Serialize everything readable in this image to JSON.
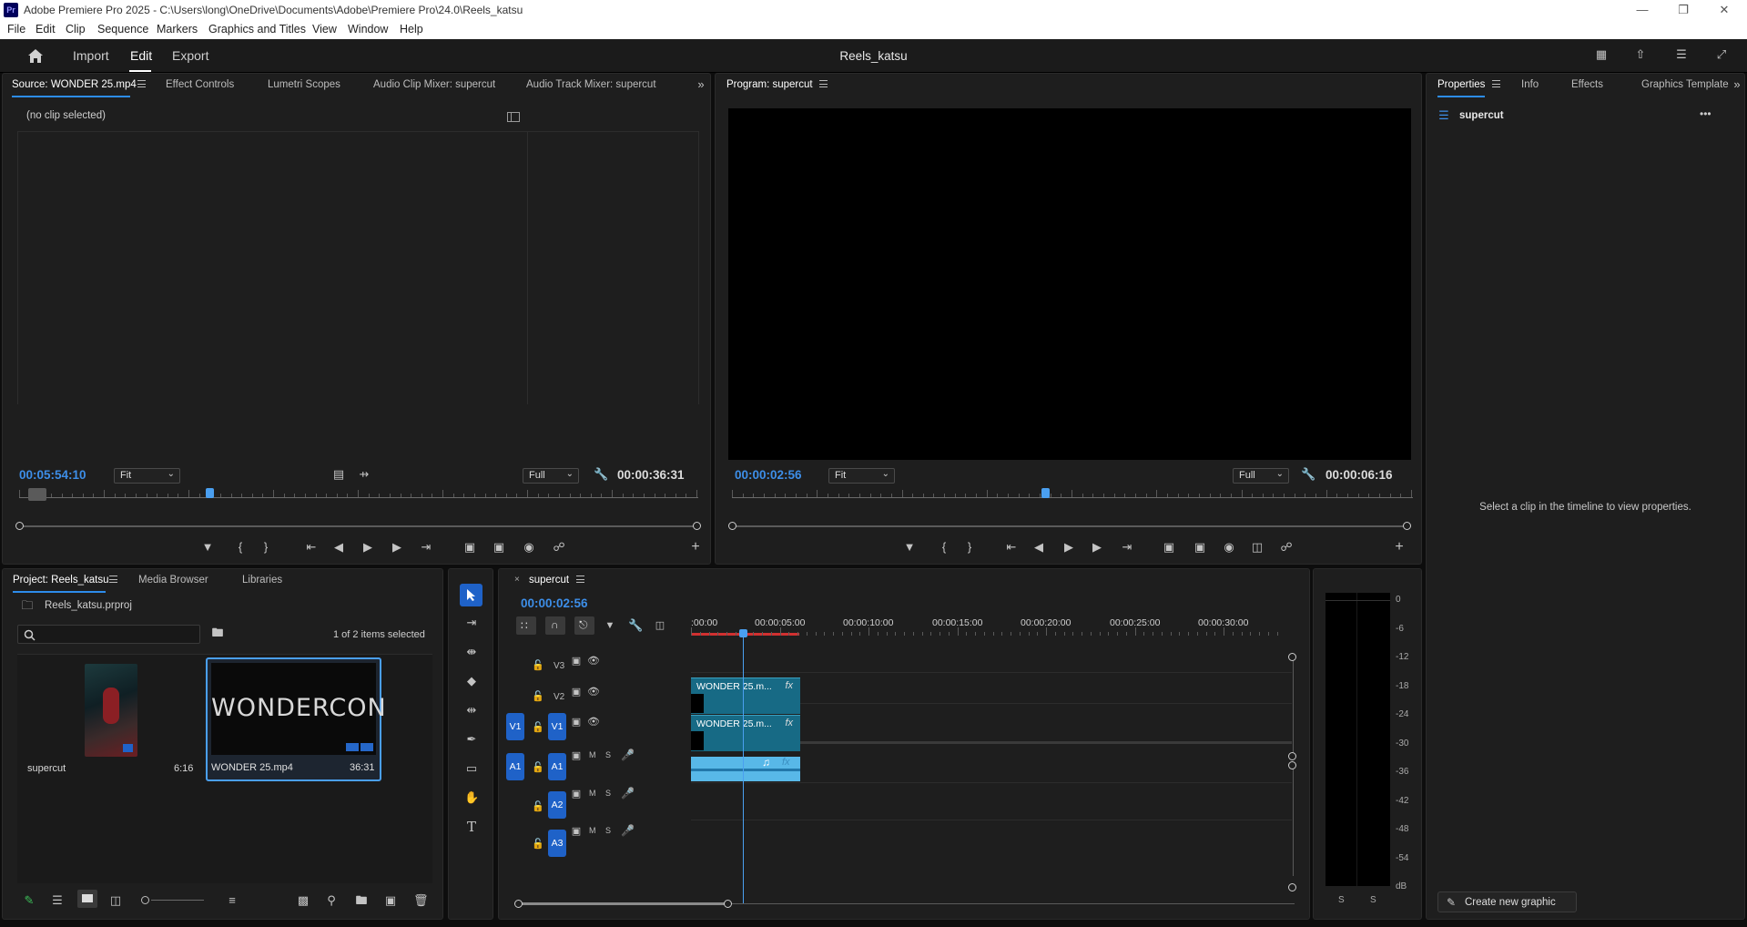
{
  "window": {
    "app_logo": "Pr",
    "title": "Adobe Premiere Pro 2025 - C:\\Users\\long\\OneDrive\\Documents\\Adobe\\Premiere Pro\\24.0\\Reels_katsu",
    "minimize": "—",
    "maximize": "❐",
    "close": "✕"
  },
  "menu": [
    "File",
    "Edit",
    "Clip",
    "Sequence",
    "Markers",
    "Graphics and Titles",
    "View",
    "Window",
    "Help"
  ],
  "workspace": {
    "home_icon": "home-icon",
    "tabs": [
      "Import",
      "Edit",
      "Export"
    ],
    "active_tab": "Edit",
    "project_title": "Reels_katsu"
  },
  "source_panel": {
    "tabs": [
      "Source: WONDER 25.mp4",
      "Effect Controls",
      "Lumetri Scopes",
      "Audio Clip Mixer: supercut",
      "Audio Track Mixer: supercut"
    ],
    "no_clip_text": "(no clip selected)",
    "timecode_current": "00:05:54:10",
    "zoom": "Fit",
    "resolution": "Full",
    "timecode_duration": "00:00:36:31",
    "playhead_fraction": 0.28
  },
  "program_panel": {
    "title": "Program: supercut",
    "timecode_current": "00:00:02:56",
    "zoom": "Fit",
    "resolution": "Full",
    "timecode_duration": "00:00:06:16",
    "playhead_fraction": 0.46
  },
  "properties_panel": {
    "tabs": [
      "Properties",
      "Info",
      "Effects",
      "Graphics Template"
    ],
    "sequence_name": "supercut",
    "more": "•••",
    "empty_text": "Select a clip in the timeline to view properties.",
    "create_button": "Create new graphic"
  },
  "project_panel": {
    "tabs": [
      "Project: Reels_katsu",
      "Media Browser",
      "Libraries"
    ],
    "project_file": "Reels_katsu.prproj",
    "search_placeholder": "",
    "selection_status": "1 of 2 items selected",
    "items": [
      {
        "name": "supercut",
        "duration": "6:16"
      },
      {
        "name": "WONDER 25.mp4",
        "duration": "36:31",
        "thumb_text": "WONDERCON"
      }
    ]
  },
  "timeline": {
    "sequence_name": "supercut",
    "timecode": "00:00:02:56",
    "ruler_labels": [
      ":00:00",
      "00:00:05:00",
      "00:00:10:00",
      "00:00:15:00",
      "00:00:20:00",
      "00:00:25:00",
      "00:00:30:00"
    ],
    "video_tracks": [
      "V3",
      "V2",
      "V1"
    ],
    "audio_tracks": [
      "A1",
      "A2",
      "A3"
    ],
    "source_patch_video": "V1",
    "source_patch_audio": "A1",
    "mute": "M",
    "solo": "S",
    "clips": [
      {
        "track": "V2",
        "label": "WONDER 25.m...",
        "fx": "fx"
      },
      {
        "track": "V1",
        "label": "WONDER 25.m...",
        "fx": "fx"
      }
    ]
  },
  "audio_meter": {
    "scale": [
      "0",
      "-6",
      "-12",
      "-18",
      "-24",
      "-30",
      "-36",
      "-42",
      "-48",
      "-54",
      "dB"
    ],
    "solo_labels": [
      "S",
      "S"
    ]
  },
  "colors": {
    "accent_blue": "#2d8ceb",
    "timecode_blue": "#3d8ee8",
    "track_blue": "#1f62c8",
    "clip_teal": "#176a85",
    "audio_clip": "#58b8e8",
    "panel_bg": "#1e1e1e"
  }
}
